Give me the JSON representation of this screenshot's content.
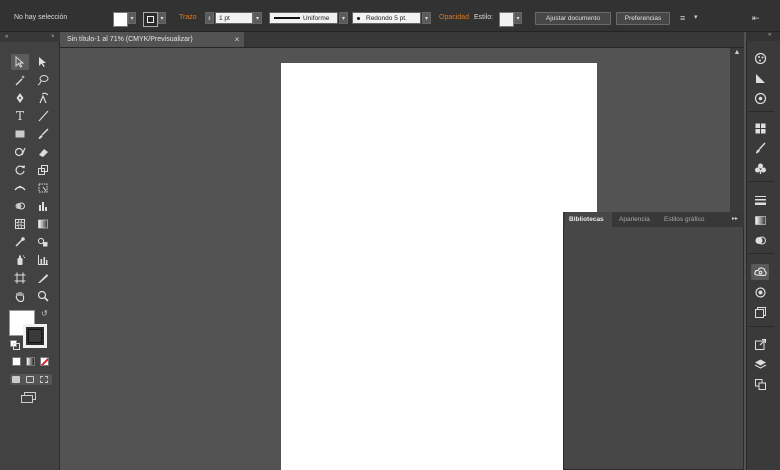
{
  "control_bar": {
    "selection_status": "No hay selección",
    "stroke_label": "Trazo",
    "stroke_weight": "1 pt",
    "stroke_profile": "Uniforme",
    "brush_definition": "Redondo 5 pt.",
    "opacity_label": "Opacidad",
    "style_label": "Estilo:",
    "document_setup_button": "Ajustar documento",
    "preferences_button": "Preferencias"
  },
  "document": {
    "tab_title": "Sin título-1 al 71% (CMYK/Previsualizar)",
    "close_glyph": "×"
  },
  "libraries_panel": {
    "tabs": [
      "Bibliotecas",
      "Apariencia",
      "Estilos gráfico"
    ],
    "active_tab": 0,
    "menu_glyph": "▸▸"
  },
  "colors": {
    "workspace_bg": "#535353",
    "toolbar_bg": "#424242",
    "control_bar_bg": "#323232",
    "accent_orange": "#e07a1d",
    "artboard": "#ffffff"
  }
}
